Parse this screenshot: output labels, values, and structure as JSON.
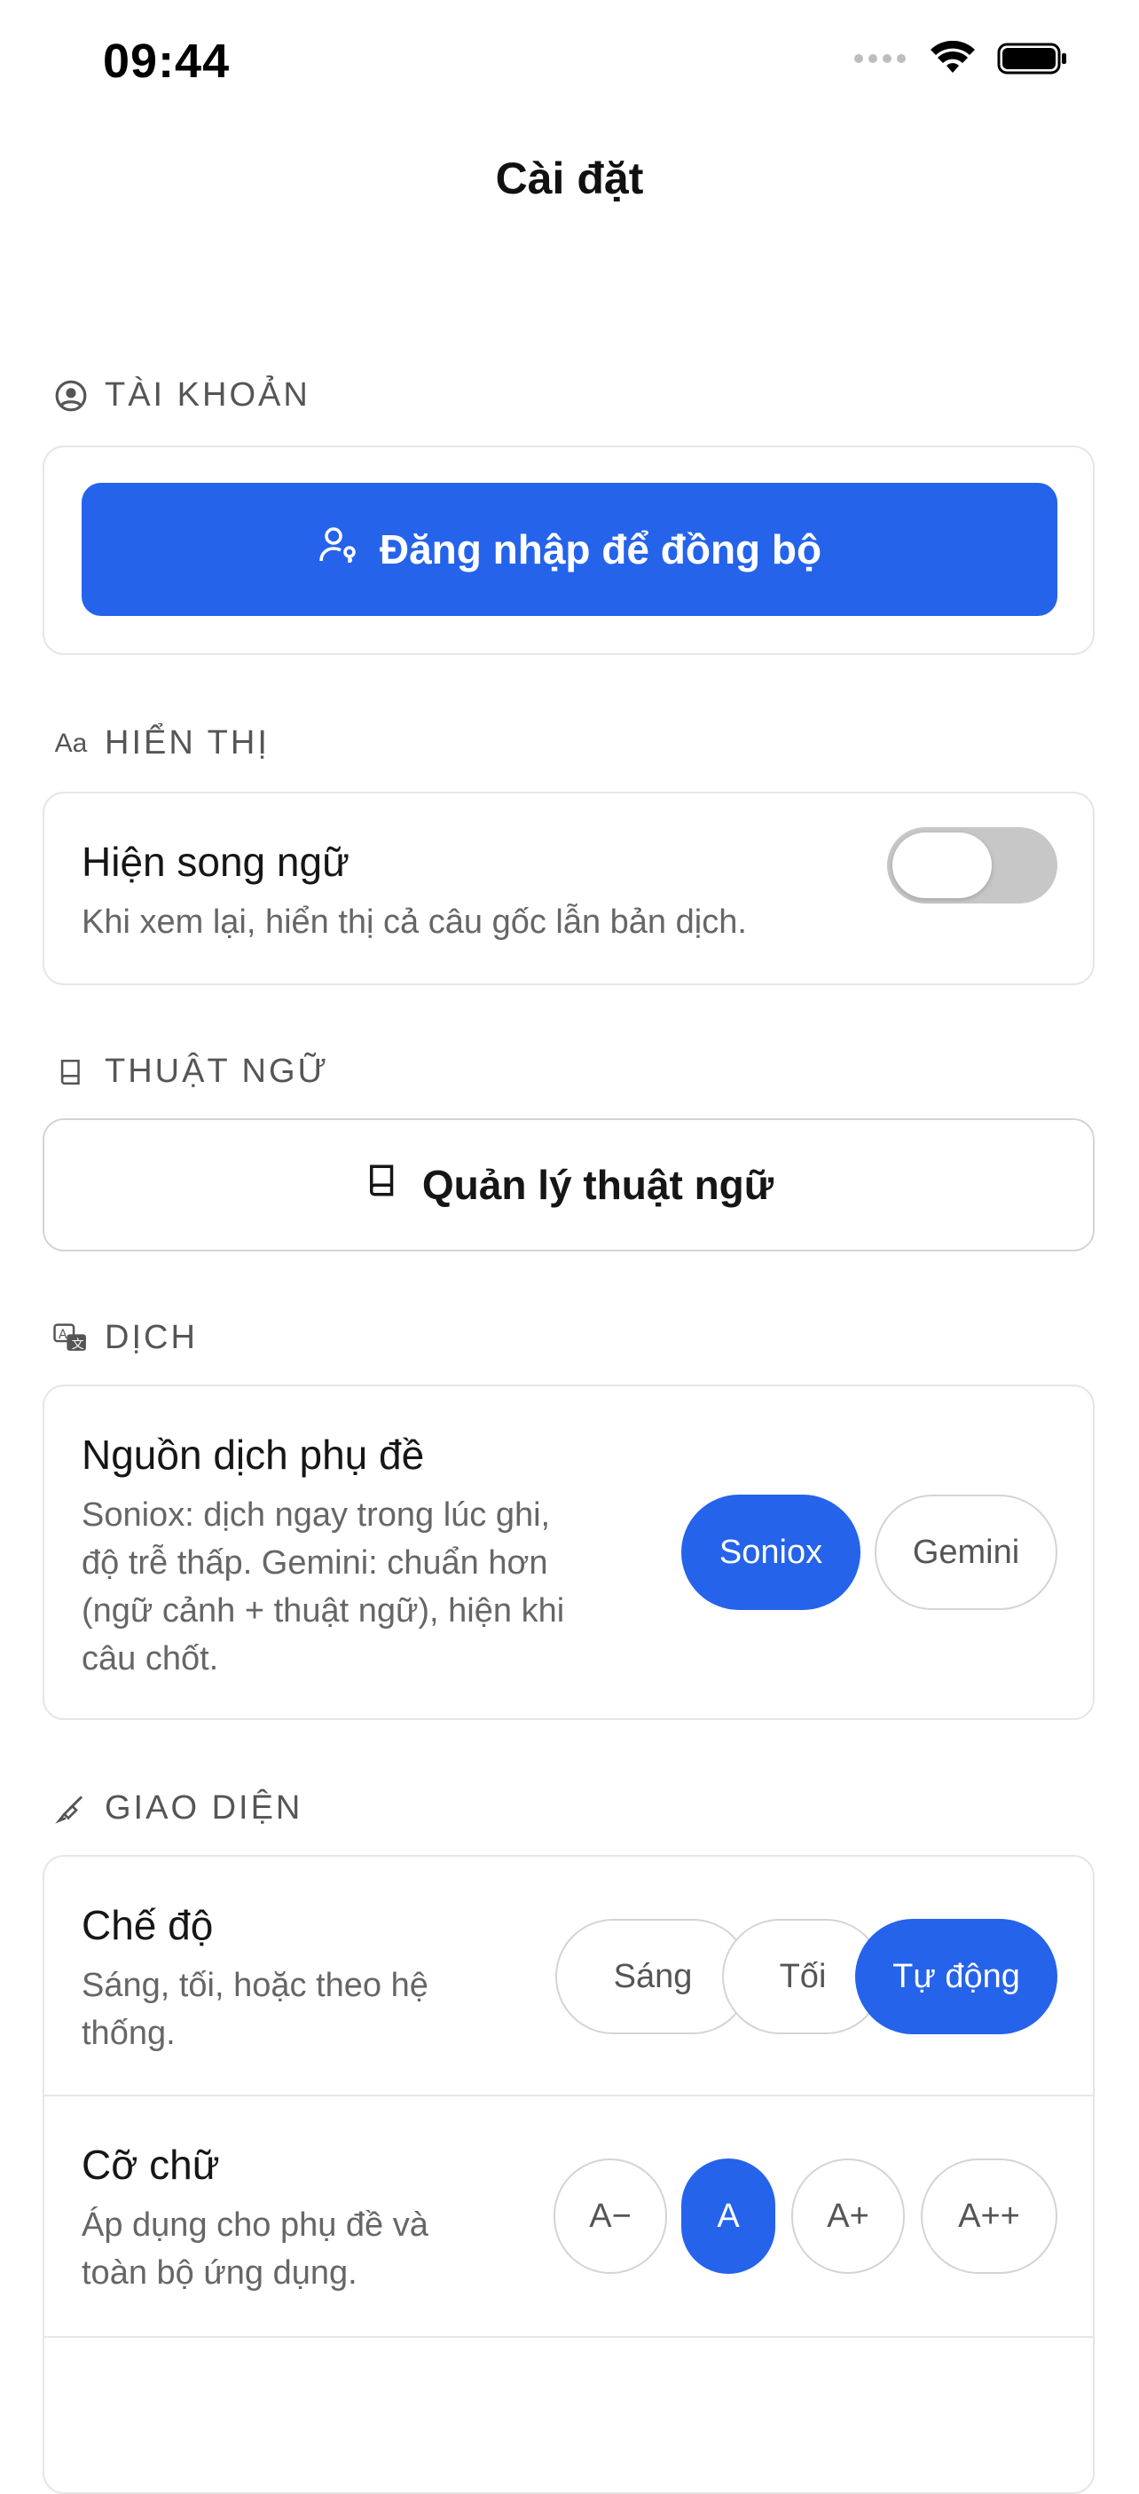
{
  "status_bar": {
    "time": "09:44"
  },
  "nav": {
    "title": "Cài đặt"
  },
  "account": {
    "section_label": "TÀI KHOẢN",
    "login_button": "Đăng nhập để đồng bộ"
  },
  "display": {
    "section_label": "HIỂN THỊ",
    "section_icon_text": "Aa",
    "bilingual_title": "Hiện song ngữ",
    "bilingual_desc": "Khi xem lại, hiển thị cả câu gốc lẫn bản dịch.",
    "bilingual_enabled": false
  },
  "glossary": {
    "section_label": "THUẬT NGỮ",
    "manage_button": "Quản lý thuật ngữ"
  },
  "translate": {
    "section_label": "DỊCH",
    "source_title": "Nguồn dịch phụ đề",
    "source_desc": [
      "Soniox: dịch ngay trong lúc ghi,",
      "độ trễ thấp. Gemini: chuẩn hơn",
      "(ngữ cảnh + thuật ngữ), hiện khi",
      "câu chốt."
    ],
    "options": [
      "Soniox",
      "Gemini"
    ],
    "selected": "Soniox"
  },
  "appearance": {
    "section_label": "GIAO DIỆN",
    "mode_title": "Chế độ",
    "mode_desc": [
      "Sáng, tối, hoặc theo hệ",
      "thống."
    ],
    "mode_options": [
      "Sáng",
      "Tối",
      "Tự động"
    ],
    "mode_selected": "Tự động",
    "font_title": "Cỡ chữ",
    "font_desc": [
      "Áp dụng cho phụ đề và",
      "toàn bộ ứng dụng."
    ],
    "font_options": [
      "A−",
      "A",
      "A+",
      "A++"
    ],
    "font_selected": "A"
  },
  "colors": {
    "accent": "#2563eb",
    "toggle_off": "#c7c7c7"
  }
}
